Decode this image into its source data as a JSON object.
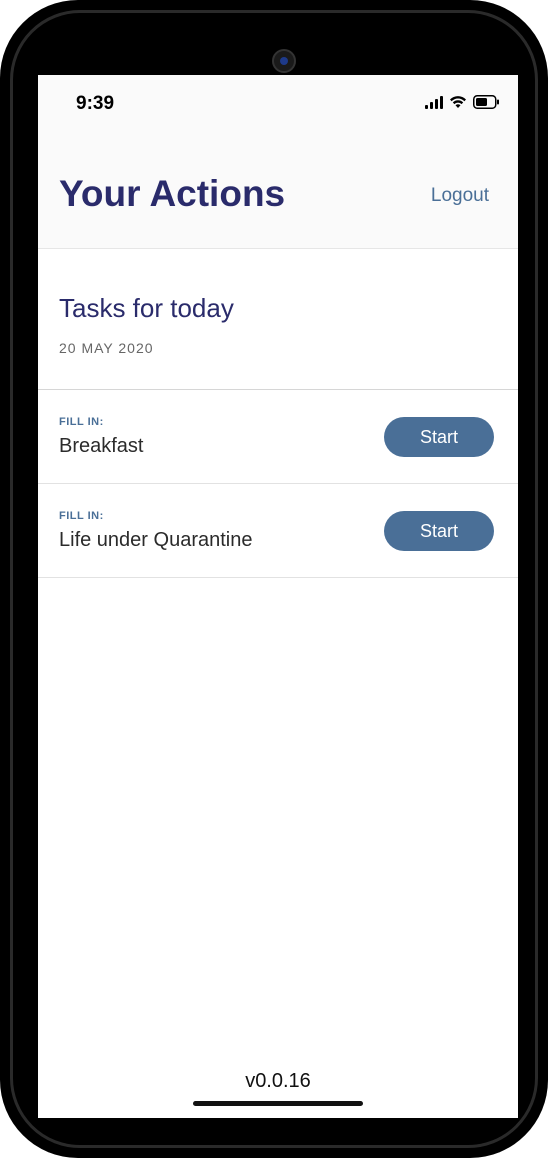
{
  "status_bar": {
    "time": "9:39",
    "icons": [
      "signal-icon",
      "wifi-icon",
      "battery-icon"
    ]
  },
  "header": {
    "title": "Your Actions",
    "logout_label": "Logout"
  },
  "section": {
    "title": "Tasks for today",
    "date": "20 MAY 2020"
  },
  "tasks": [
    {
      "kicker": "FILL IN:",
      "name": "Breakfast",
      "button_label": "Start"
    },
    {
      "kicker": "FILL IN:",
      "name": "Life under Quarantine",
      "button_label": "Start"
    }
  ],
  "footer": {
    "version": "v0.0.16"
  },
  "colors": {
    "title": "#2a2b6b",
    "accent": "#4a6f97",
    "header_bg": "#fafafa"
  }
}
